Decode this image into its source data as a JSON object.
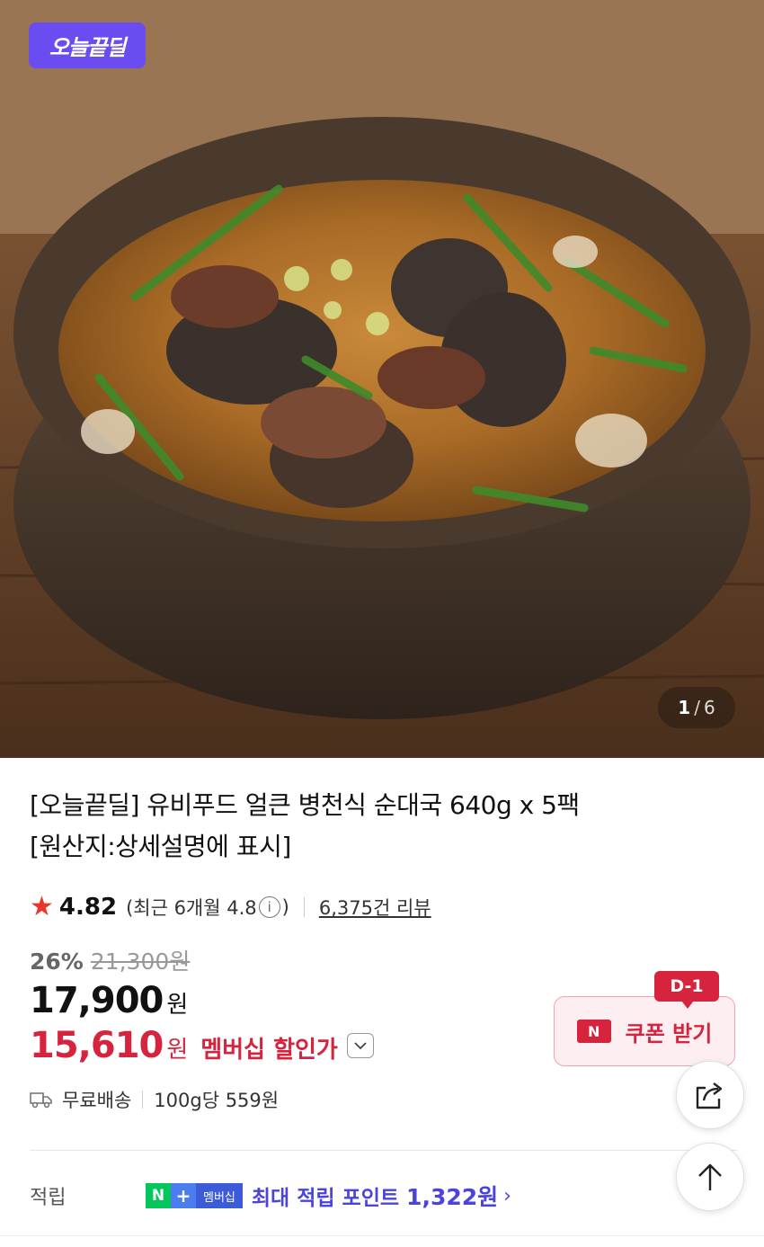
{
  "hero": {
    "badge": "오늘끝딜",
    "counter_current": "1",
    "counter_sep": "/",
    "counter_total": "6",
    "image_icon": "stew-photo"
  },
  "product": {
    "title_line1": "[오늘끝딜] 유비푸드 얼큰 병천식 순대국 640g x 5팩",
    "title_line2": "[원산지:상세설명에 표시]"
  },
  "rating": {
    "star": "★",
    "value": "4.82",
    "recent_prefix": "(최근 6개월 4.8",
    "recent_suffix": ")",
    "info_symbol": "i",
    "reviews": "6,375건 리뷰"
  },
  "pricing": {
    "discount": "26%",
    "original": "21,300원",
    "price": "17,900",
    "price_unit": "원",
    "member_price": "15,610",
    "member_unit": "원",
    "member_label": "멤버십 할인가"
  },
  "coupon": {
    "d_day": "D-1",
    "n_mark": "N",
    "label": "쿠폰 받기",
    "accent": "#d6243f"
  },
  "shipping": {
    "free": "무료배송",
    "unit_price": "100g당 559원"
  },
  "points": {
    "label": "적립",
    "n": "N",
    "plus": "+",
    "membership": "멤버십",
    "text_prefix": "최대 적립 포인트",
    "amount": "1,322원",
    "arrow": "›"
  },
  "colors": {
    "badge_purple": "#6b4cf0",
    "price_red": "#d6243f",
    "naver_green": "#03c75a",
    "points_blue": "#4a45d8"
  }
}
